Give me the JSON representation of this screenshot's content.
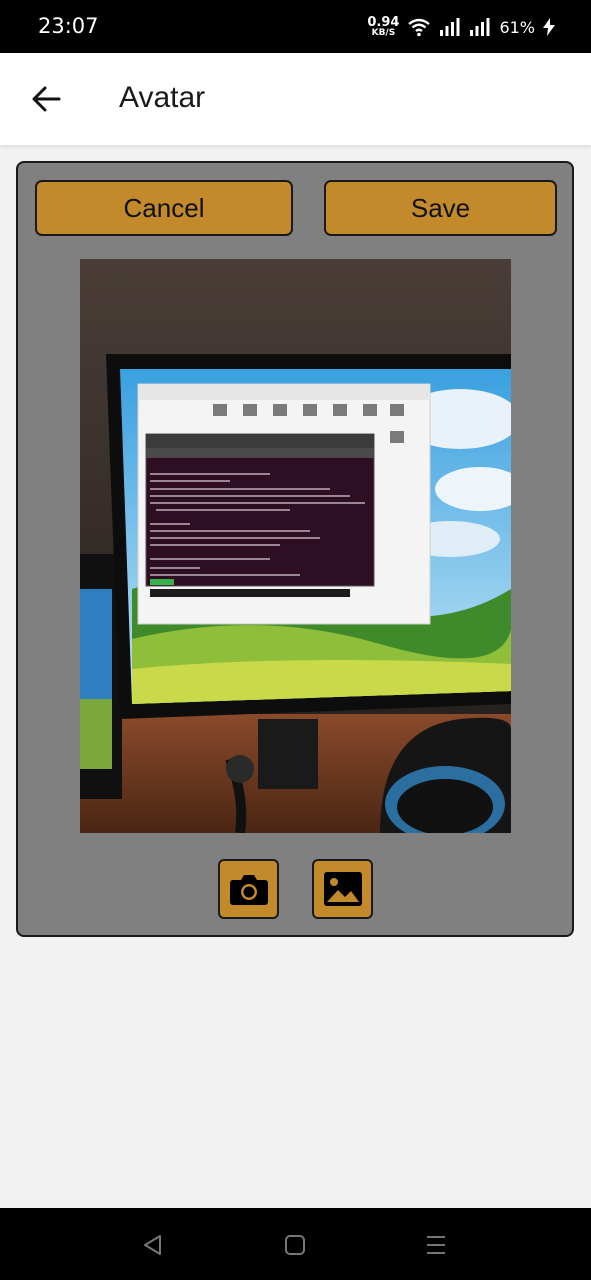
{
  "status_bar": {
    "time": "23:07",
    "net_speed_value": "0.94",
    "net_speed_unit": "KB/S",
    "battery": "61%",
    "icons": [
      "wifi-icon",
      "signal-icon",
      "signal-icon",
      "charging-icon"
    ]
  },
  "app_bar": {
    "title": "Avatar",
    "back_icon": "arrow-left-icon"
  },
  "editor": {
    "cancel_label": "Cancel",
    "save_label": "Save",
    "camera_icon": "camera-icon",
    "gallery_icon": "image-icon"
  },
  "colors": {
    "accent": "#c28a2a",
    "panel": "#808080",
    "status_bar": "#000000",
    "background": "#f2f2f2"
  },
  "nav_bar": {
    "icons": [
      "nav-back-icon",
      "nav-home-icon",
      "nav-menu-icon"
    ]
  }
}
